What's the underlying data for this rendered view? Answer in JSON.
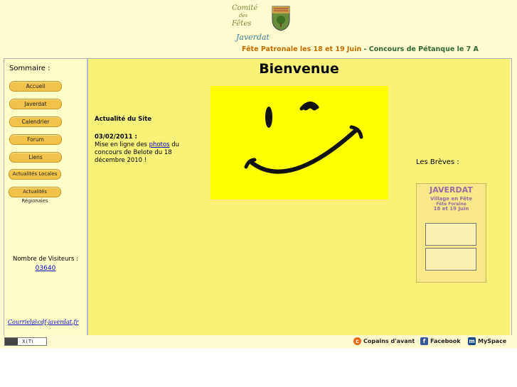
{
  "header": {
    "logo_line1": "Comité",
    "logo_line2": "des",
    "logo_line3": "Fêtes",
    "logo_sub": "Javerdat",
    "marquee_item1": "Fête Patronale les 18 et 19 Juin",
    "marquee_sep": " - ",
    "marquee_item2": "Concours de Pétanque le 7 A"
  },
  "sidebar": {
    "title": "Sommaire :",
    "items": [
      {
        "label": "Accueil"
      },
      {
        "label": "Javerdat"
      },
      {
        "label": "Calendrier"
      },
      {
        "label": "Forum"
      },
      {
        "label": "Liens"
      },
      {
        "label": "Actualités Locales"
      },
      {
        "label": "Actualités Régionales"
      }
    ],
    "visitors_label": "Nombre de Visiteurs :",
    "visitors_count": "03640",
    "email": "Courriel@cdf-javerdat.fr"
  },
  "main": {
    "title": "Bienvenue",
    "news_title": "Actualité du Site",
    "news_date": "03/02/2011 :",
    "news_text_before": "Mise en ligne des ",
    "news_link": "photos",
    "news_text_after": " du concours de Belote du 18 décembre 2010 !",
    "breves_label": "Les Brèves :",
    "poster_title": "JAVERDAT",
    "poster_sub1": "Village en Fête",
    "poster_sub2": "Fête Foraine",
    "poster_sub3": "18 et 19 Juin"
  },
  "footer": {
    "xiti_label": "XiTi",
    "copains": "Copains d'avant",
    "facebook": "Facebook",
    "myspace": "MySpace"
  },
  "colors": {
    "page_bg": "#fffdd0",
    "main_bg": "#fbf27a",
    "smiley_bg": "#ffff00",
    "nav_button": "#f2c24a",
    "link": "#0000cc"
  }
}
